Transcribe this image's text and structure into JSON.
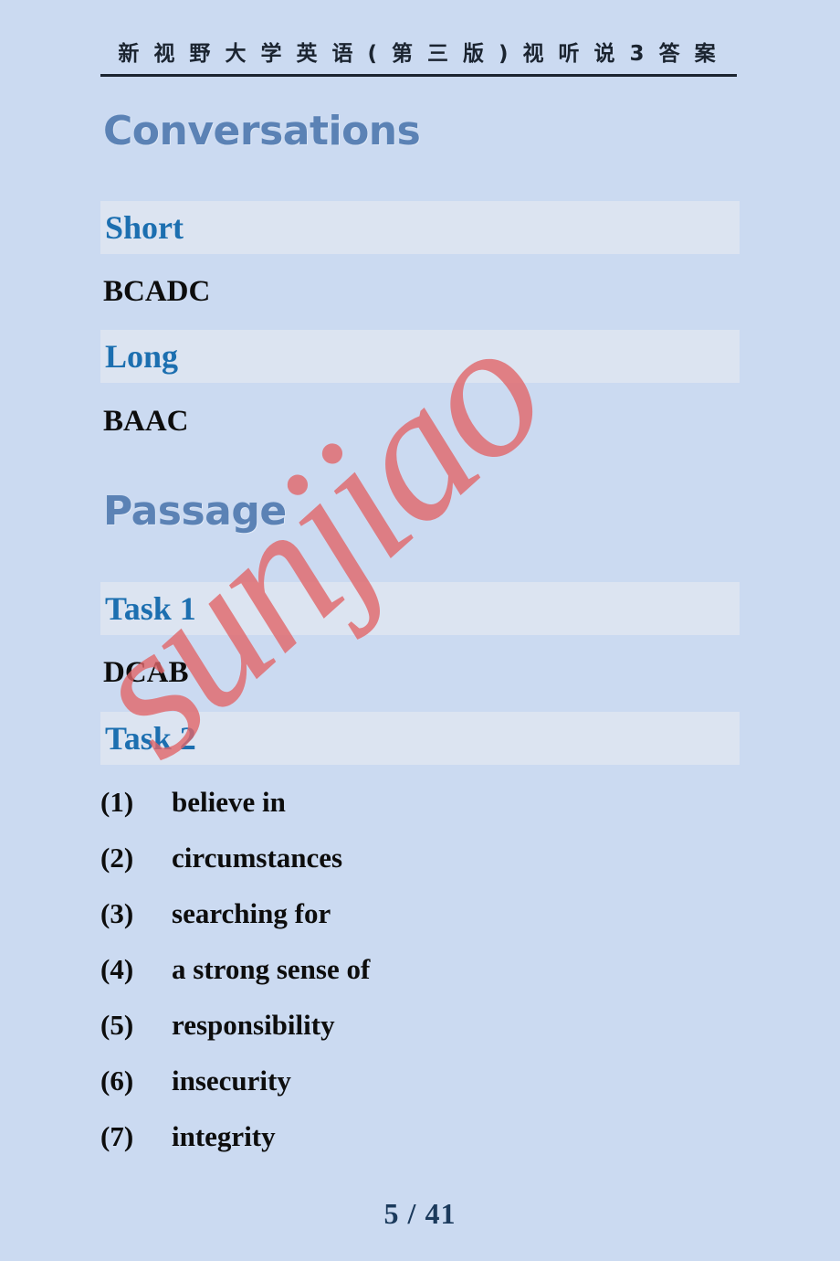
{
  "header": {
    "title": "新 视 野 大 学 英 语 ( 第 三 版 ) 视 听 说 3 答 案"
  },
  "watermark": {
    "text": "sunjiao",
    "color": "#e2666a"
  },
  "colors": {
    "page_background": "#cbdaf1",
    "band_background": "#dce4f1",
    "big_heading": "#5b82b5",
    "band_label": "#1c6fb0",
    "answer_text": "#0d0d0d",
    "footer": "#1b3a5c",
    "rule": "#1b2430"
  },
  "sections": {
    "conversations": {
      "heading": "Conversations",
      "short": {
        "label": "Short",
        "answer": "BCADC"
      },
      "long": {
        "label": "Long",
        "answer": "BAAC"
      }
    },
    "passage": {
      "heading": "Passage",
      "task1": {
        "label": "Task 1",
        "answer": "DCAB"
      },
      "task2": {
        "label": "Task 2",
        "items": [
          {
            "number": "(1)",
            "text": "believe in"
          },
          {
            "number": "(2)",
            "text": "circumstances"
          },
          {
            "number": "(3)",
            "text": "searching for"
          },
          {
            "number": "(4)",
            "text": "a strong sense of"
          },
          {
            "number": "(5)",
            "text": "responsibility"
          },
          {
            "number": "(6)",
            "text": "insecurity"
          },
          {
            "number": "(7)",
            "text": "integrity"
          }
        ]
      }
    }
  },
  "footer": {
    "page_indicator": "5 / 41"
  }
}
